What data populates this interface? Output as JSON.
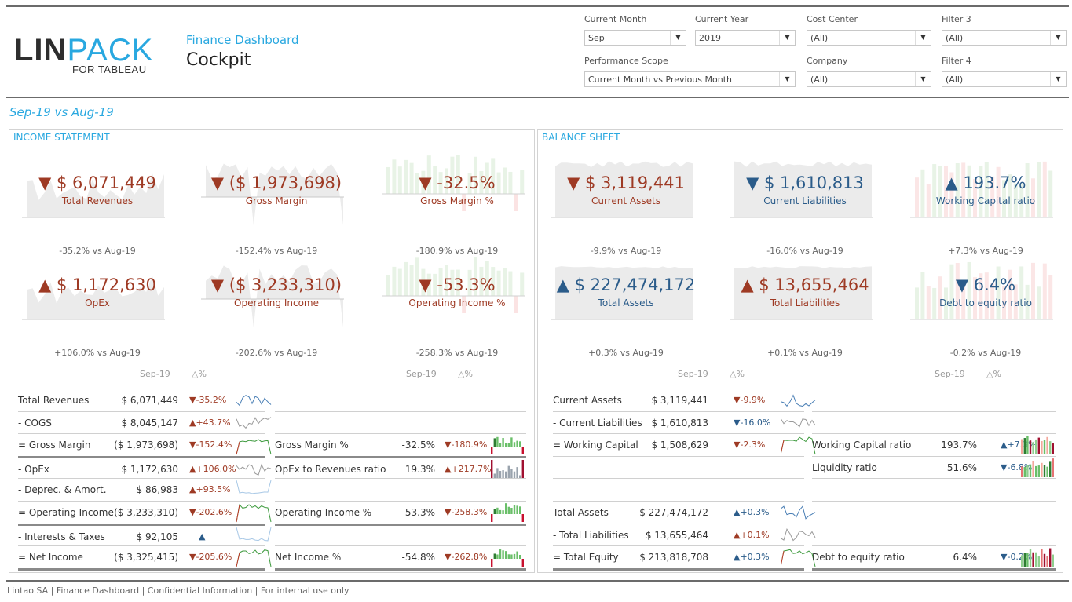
{
  "header": {
    "logo_main": "LIN",
    "logo_accent": "PACK",
    "logo_sub": "FOR TABLEAU",
    "app_subtitle": "Finance Dashboard",
    "app_title": "Cockpit"
  },
  "filters": [
    {
      "label": "Current Month",
      "value": "Sep"
    },
    {
      "label": "Current Year",
      "value": "2019"
    },
    {
      "label": "Cost Center",
      "value": "(All)"
    },
    {
      "label": "Filter 3",
      "value": "(All)"
    },
    {
      "label": "Performance Scope",
      "value": "Current Month vs Previous Month"
    },
    {
      "label": "Company",
      "value": "(All)"
    },
    {
      "label": "Filter 4",
      "value": "(All)"
    }
  ],
  "period_label": "Sep-19 vs Aug-19",
  "icons": {
    "down": "▼",
    "up": "▲",
    "dropdown": "▼"
  },
  "colors": {
    "accent": "#29a8e0",
    "negative": "#9e3a24",
    "positive": "#2b5c8a"
  },
  "income_statement": {
    "title": "INCOME STATEMENT",
    "kpis": [
      {
        "arrow": "▼",
        "value": "$ 6,071,449",
        "name": "Total Revenues",
        "compare": "-35.2% vs Aug-19",
        "tone": "red",
        "chart": "area"
      },
      {
        "arrow": "▼",
        "value": "($ 1,973,698)",
        "name": "Gross Margin",
        "compare": "-152.4% vs Aug-19",
        "tone": "red",
        "chart": "area-neg"
      },
      {
        "arrow": "▼",
        "value": "-32.5%",
        "name": "Gross Margin %",
        "compare": "-180.9% vs Aug-19",
        "tone": "red",
        "chart": "bars"
      },
      {
        "arrow": "▲",
        "value": "$ 1,172,630",
        "name": "OpEx",
        "compare": "+106.0% vs Aug-19",
        "tone": "red",
        "chart": "area"
      },
      {
        "arrow": "▼",
        "value": "($ 3,233,310)",
        "name": "Operating Income",
        "compare": "-202.6% vs Aug-19",
        "tone": "red",
        "chart": "area-neg"
      },
      {
        "arrow": "▼",
        "value": "-53.3%",
        "name": "Operating Income %",
        "compare": "-258.3% vs Aug-19",
        "tone": "red",
        "chart": "bars"
      }
    ],
    "table_header": {
      "period": "Sep-19",
      "delta": "△%"
    },
    "left_rows": [
      {
        "label": "Total Revenues",
        "value": "$ 6,071,449",
        "arrow": "▼",
        "delta": "-35.2%",
        "tone": "red",
        "spark": "blue"
      },
      {
        "label": "- COGS",
        "value": "$ 8,045,147",
        "arrow": "▲",
        "delta": "+43.7%",
        "tone": "red",
        "spark": "grey"
      },
      {
        "label": "= Gross Margin",
        "value": "($ 1,973,698)",
        "arrow": "▼",
        "delta": "-152.4%",
        "tone": "red",
        "spark": "green"
      },
      {
        "label": "- OpEx",
        "value": "$ 1,172,630",
        "arrow": "▲",
        "delta": "+106.0%",
        "tone": "red",
        "spark": "grey"
      },
      {
        "label": "- Deprec. & Amort.",
        "value": "$ 86,983",
        "arrow": "▲",
        "delta": "+93.5%",
        "tone": "red",
        "spark": "lightblue"
      },
      {
        "label": "= Operating Income",
        "value": "($ 3,233,310)",
        "arrow": "▼",
        "delta": "-202.6%",
        "tone": "red",
        "spark": "green"
      },
      {
        "label": "- Interests & Taxes",
        "value": "$ 92,105",
        "arrow": "▲",
        "delta": "",
        "tone": "blue",
        "spark": "lightblue"
      },
      {
        "label": "= Net Income",
        "value": "($ 3,325,415)",
        "arrow": "▼",
        "delta": "-205.6%",
        "tone": "red",
        "spark": "green"
      }
    ],
    "right_rows": [
      {
        "label": "",
        "value": "",
        "arrow": "",
        "delta": ""
      },
      {
        "label": "",
        "value": "",
        "arrow": "",
        "delta": ""
      },
      {
        "label": "Gross Margin %",
        "value": "-32.5%",
        "arrow": "▼",
        "delta": "-180.9%",
        "tone": "red",
        "spark": "bars-green"
      },
      {
        "label": "OpEx to Revenues ratio",
        "value": "19.3%",
        "arrow": "▲",
        "delta": "+217.7%",
        "tone": "red",
        "spark": "bars-grey"
      },
      {
        "label": "",
        "value": "",
        "arrow": "",
        "delta": ""
      },
      {
        "label": "Operating Income %",
        "value": "-53.3%",
        "arrow": "▼",
        "delta": "-258.3%",
        "tone": "red",
        "spark": "bars-green"
      },
      {
        "label": "",
        "value": "",
        "arrow": "",
        "delta": ""
      },
      {
        "label": "Net Income %",
        "value": "-54.8%",
        "arrow": "▼",
        "delta": "-262.8%",
        "tone": "red",
        "spark": "bars-green"
      }
    ]
  },
  "balance_sheet": {
    "title": "BALANCE SHEET",
    "kpis": [
      {
        "arrow": "▼",
        "value": "$ 3,119,441",
        "name": "Current Assets",
        "compare": "-9.9% vs Aug-19",
        "tone": "red",
        "chart": "area-full"
      },
      {
        "arrow": "▼",
        "value": "$ 1,610,813",
        "name": "Current Liabilities",
        "compare": "-16.0% vs Aug-19",
        "tone": "blue",
        "chart": "area-full"
      },
      {
        "arrow": "▲",
        "value": "193.7%",
        "name": "Working Capital ratio",
        "compare": "+7.3% vs Aug-19",
        "tone": "blue",
        "chart": "bars-mixed"
      },
      {
        "arrow": "▲",
        "value": "$ 227,474,172",
        "name": "Total Assets",
        "compare": "+0.3% vs Aug-19",
        "tone": "blue",
        "chart": "area-flat"
      },
      {
        "arrow": "▲",
        "value": "$ 13,655,464",
        "name": "Total Liabilities",
        "compare": "+0.1% vs Aug-19",
        "tone": "red",
        "chart": "area-flat"
      },
      {
        "arrow": "▼",
        "value": "6.4%",
        "name": "Debt to equity ratio",
        "compare": "-0.2% vs Aug-19",
        "tone": "blue",
        "chart": "bars-mixed"
      }
    ],
    "table_header": {
      "period": "Sep-19",
      "delta": "△%"
    },
    "left_rows": [
      {
        "label": "Current Assets",
        "value": "$ 3,119,441",
        "arrow": "▼",
        "delta": "-9.9%",
        "tone": "red",
        "spark": "blue"
      },
      {
        "label": "- Current Liabilities",
        "value": "$ 1,610,813",
        "arrow": "▼",
        "delta": "-16.0%",
        "tone": "blue",
        "spark": "grey"
      },
      {
        "label": "= Working Capital",
        "value": "$ 1,508,629",
        "arrow": "▼",
        "delta": "-2.3%",
        "tone": "red",
        "spark": "green"
      },
      {
        "label": "",
        "value": "",
        "arrow": "",
        "delta": ""
      },
      {
        "label": "",
        "value": "",
        "arrow": "",
        "delta": ""
      },
      {
        "label": "Total Assets",
        "value": "$ 227,474,172",
        "arrow": "▲",
        "delta": "+0.3%",
        "tone": "blue",
        "spark": "blue"
      },
      {
        "label": "- Total Liabilities",
        "value": "$ 13,655,464",
        "arrow": "▲",
        "delta": "+0.1%",
        "tone": "red",
        "spark": "grey"
      },
      {
        "label": "= Total Equity",
        "value": "$ 213,818,708",
        "arrow": "▲",
        "delta": "+0.3%",
        "tone": "blue",
        "spark": "green"
      }
    ],
    "right_rows": [
      {
        "label": "",
        "value": "",
        "arrow": "",
        "delta": ""
      },
      {
        "label": "",
        "value": "",
        "arrow": "",
        "delta": ""
      },
      {
        "label": "Working Capital ratio",
        "value": "193.7%",
        "arrow": "▲",
        "delta": "+7.3%",
        "tone": "blue",
        "spark": "bars-mixed"
      },
      {
        "label": "Liquidity ratio",
        "value": "51.6%",
        "arrow": "▼",
        "delta": "-6.8%",
        "tone": "blue",
        "spark": "bars-mixed"
      },
      {
        "label": "",
        "value": "",
        "arrow": "",
        "delta": ""
      },
      {
        "label": "",
        "value": "",
        "arrow": "",
        "delta": ""
      },
      {
        "label": "",
        "value": "",
        "arrow": "",
        "delta": ""
      },
      {
        "label": "Debt to equity ratio",
        "value": "6.4%",
        "arrow": "▼",
        "delta": "-0.2%",
        "tone": "blue",
        "spark": "bars-mixed"
      }
    ]
  },
  "footer": "Lintao SA | Finance Dashboard | Confidential Information | For internal use only"
}
